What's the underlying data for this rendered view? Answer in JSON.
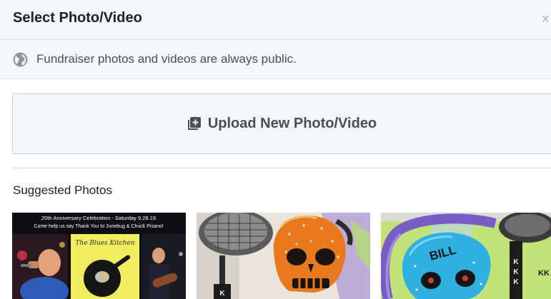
{
  "dialog": {
    "title": "Select Photo/Video",
    "close_glyph": "×"
  },
  "notice": {
    "icon": "globe-icon",
    "text": "Fundraiser photos and videos are always public."
  },
  "upload": {
    "icon": "add-photo-icon",
    "label": "Upload New Photo/Video"
  },
  "suggested": {
    "label": "Suggested Photos",
    "photos": [
      {
        "kind": "event-flyer",
        "caption_line1": "20th Anniversary Celebration - Saturday 9.28.19",
        "caption_line2": "Come help us say Thank You to Junebug & Chuck Pisano!",
        "logo_text": "The Blues Kitchen"
      },
      {
        "kind": "orange-skull-sculpture"
      },
      {
        "kind": "blue-skull-sculpture",
        "sign_text": "KK",
        "skull_text": "BILL"
      }
    ]
  },
  "colors": {
    "header_bg": "#f5f6f7",
    "border": "#dddfe2",
    "text_secondary": "#4b4f56",
    "flyer_yellow": "#f0ee60",
    "skull_orange": "#e8791e",
    "skull_blue": "#2fb0e0",
    "ribbon_purple": "#7a5cc7"
  }
}
